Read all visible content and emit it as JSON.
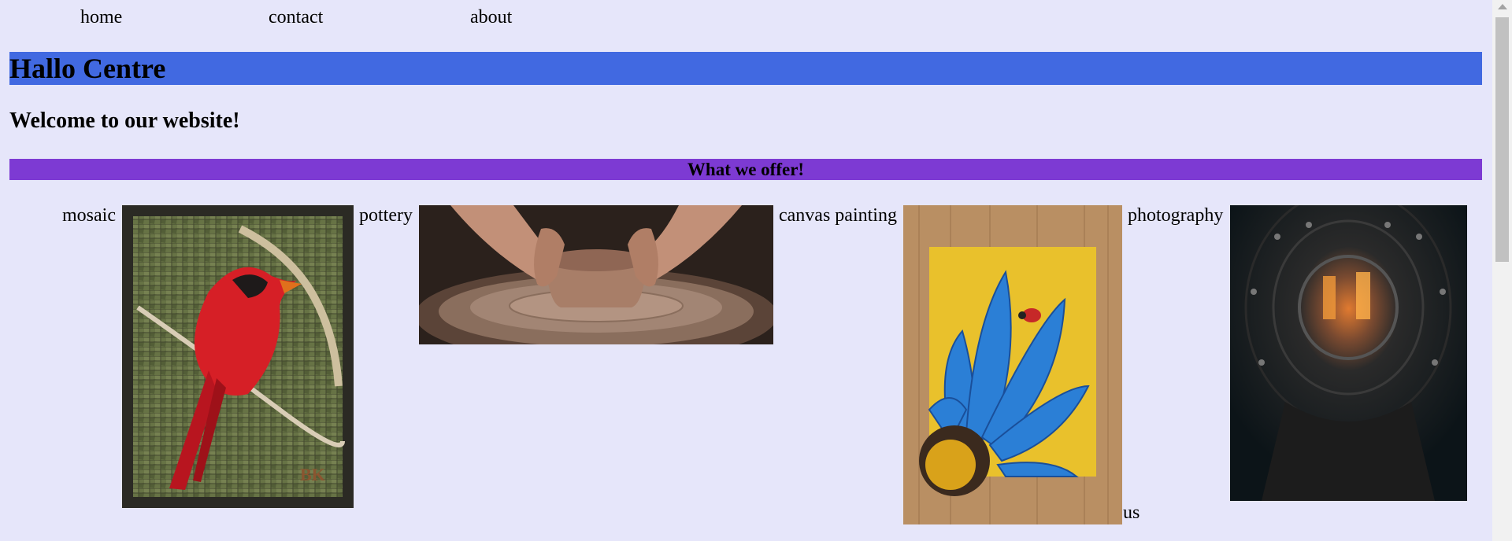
{
  "nav": {
    "items": [
      {
        "label": "home"
      },
      {
        "label": "contact"
      },
      {
        "label": "about"
      }
    ]
  },
  "header": {
    "title": "Hallo Centre",
    "welcome": "Welcome to our website!"
  },
  "offers": {
    "heading": "What we offer!",
    "items": [
      {
        "label": "mosaic",
        "image": "cardinal-mosaic"
      },
      {
        "label": "pottery",
        "image": "hands-shaping-clay-pot"
      },
      {
        "label": "canvas painting",
        "image": "blue-flower-painting-with-ladybug"
      },
      {
        "label": "photography",
        "image": "looking-through-metal-pipe"
      }
    ],
    "trailing_text": "us"
  },
  "colors": {
    "page_background": "#e6e6fa",
    "title_bar": "#4169e1",
    "offer_bar": "#7d3ad3"
  }
}
